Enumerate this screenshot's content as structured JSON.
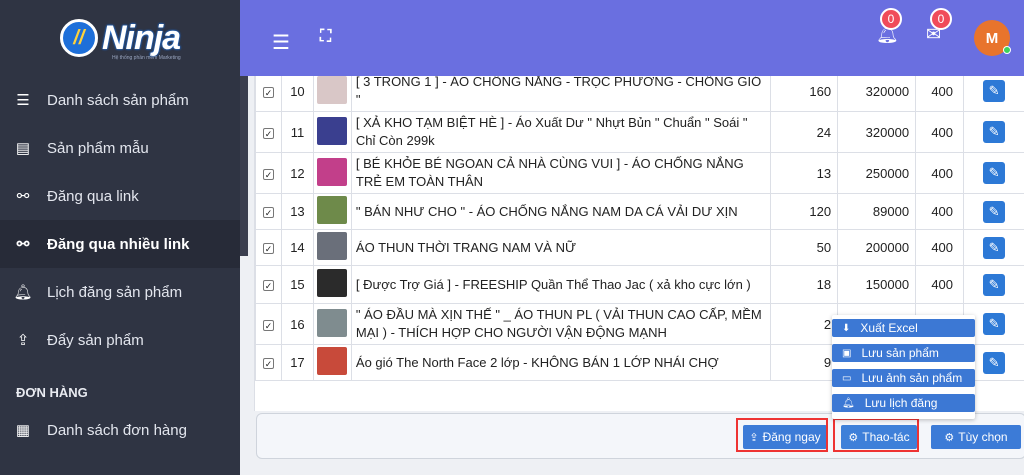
{
  "brand": {
    "name": "Ninja",
    "tagline": "Hệ thống phần mềm Marketing"
  },
  "sidebar": {
    "items": [
      {
        "label": "Danh sách sản phẩm",
        "icon": "list-icon"
      },
      {
        "label": "Sản phẩm mẫu",
        "icon": "file-excel-icon"
      },
      {
        "label": "Đăng qua link",
        "icon": "link-icon"
      },
      {
        "label": "Đăng qua nhiều link",
        "icon": "link-icon",
        "active": true
      },
      {
        "label": "Lịch đăng sản phẩm",
        "icon": "bell-icon"
      },
      {
        "label": "Đẩy sản phẩm",
        "icon": "upload-icon"
      }
    ],
    "section_orders": "ĐƠN HÀNG",
    "order_items": [
      {
        "label": "Danh sách đơn hàng",
        "icon": "list-alt-icon"
      }
    ]
  },
  "topbar": {
    "notifications_count": "0",
    "messages_count": "0",
    "avatar_initial": "M"
  },
  "table": {
    "rows": [
      {
        "num": "10",
        "name": "[ 3 TRONG 1 ] - ÁO CHỐNG NẮNG - TRỌC PHƯƠNG - CHỐNG GIÓ \"",
        "qty": "160",
        "price": "320000",
        "weight": "400",
        "thumb_color": "#d9c7c7"
      },
      {
        "num": "11",
        "name": "[ XẢ KHO TẠM BIỆT HÈ ] - Áo Xuất Dư \" Nhựt Bủn \" Chuẩn \" Soái \" Chỉ Còn 299k",
        "qty": "24",
        "price": "320000",
        "weight": "400",
        "thumb_color": "#3a3f8f"
      },
      {
        "num": "12",
        "name": "[ BÉ KHỎE BÉ NGOAN CẢ NHÀ CÙNG VUI ] - ÁO CHỐNG NẮNG TRẺ EM TOÀN THÂN",
        "qty": "13",
        "price": "250000",
        "weight": "400",
        "thumb_color": "#c23f8a"
      },
      {
        "num": "13",
        "name": "\" BÁN NHƯ CHO \" - ÁO CHỐNG NẮNG NAM DA CÁ VẢI DƯ XỊN",
        "qty": "120",
        "price": "89000",
        "weight": "400",
        "thumb_color": "#6e8a4a"
      },
      {
        "num": "14",
        "name": "ÁO THUN THỜI TRANG NAM VÀ NỮ",
        "qty": "50",
        "price": "200000",
        "weight": "400",
        "thumb_color": "#6a6f7a"
      },
      {
        "num": "15",
        "name": "[ Được Trợ Giá ] - FREESHIP Quần Thể Thao Jac ( xả kho cực lớn )",
        "qty": "18",
        "price": "150000",
        "weight": "400",
        "thumb_color": "#2b2b2b"
      },
      {
        "num": "16",
        "name": "\" ÁO ĐẦU MÀ XỊN THẾ \" _ ÁO THUN PL ( VẢI THUN CAO CẤP, MỀM MẠI ) - THÍCH HỢP CHO NGƯỜI VẬN ĐỘNG MẠNH",
        "qty": "2",
        "price": "",
        "weight": "",
        "thumb_color": "#7f8c8f"
      },
      {
        "num": "17",
        "name": "Áo gió The North Face 2 lớp - KHÔNG BÁN 1 LỚP NHÁI CHỢ",
        "qty": "9",
        "price": "",
        "weight": "",
        "thumb_color": "#c84a3a"
      }
    ]
  },
  "actions": {
    "post_now": "Đăng ngay",
    "operations": "Thao-tác",
    "options": "Tùy chọn"
  },
  "menu": {
    "items": [
      {
        "label": "Xuất Excel",
        "icon": "download-icon"
      },
      {
        "label": "Lưu sản phẩm",
        "icon": "save-icon"
      },
      {
        "label": "Lưu ảnh sản phẩm",
        "icon": "image-icon"
      },
      {
        "label": "Lưu lịch đăng",
        "icon": "bell-icon"
      }
    ]
  }
}
